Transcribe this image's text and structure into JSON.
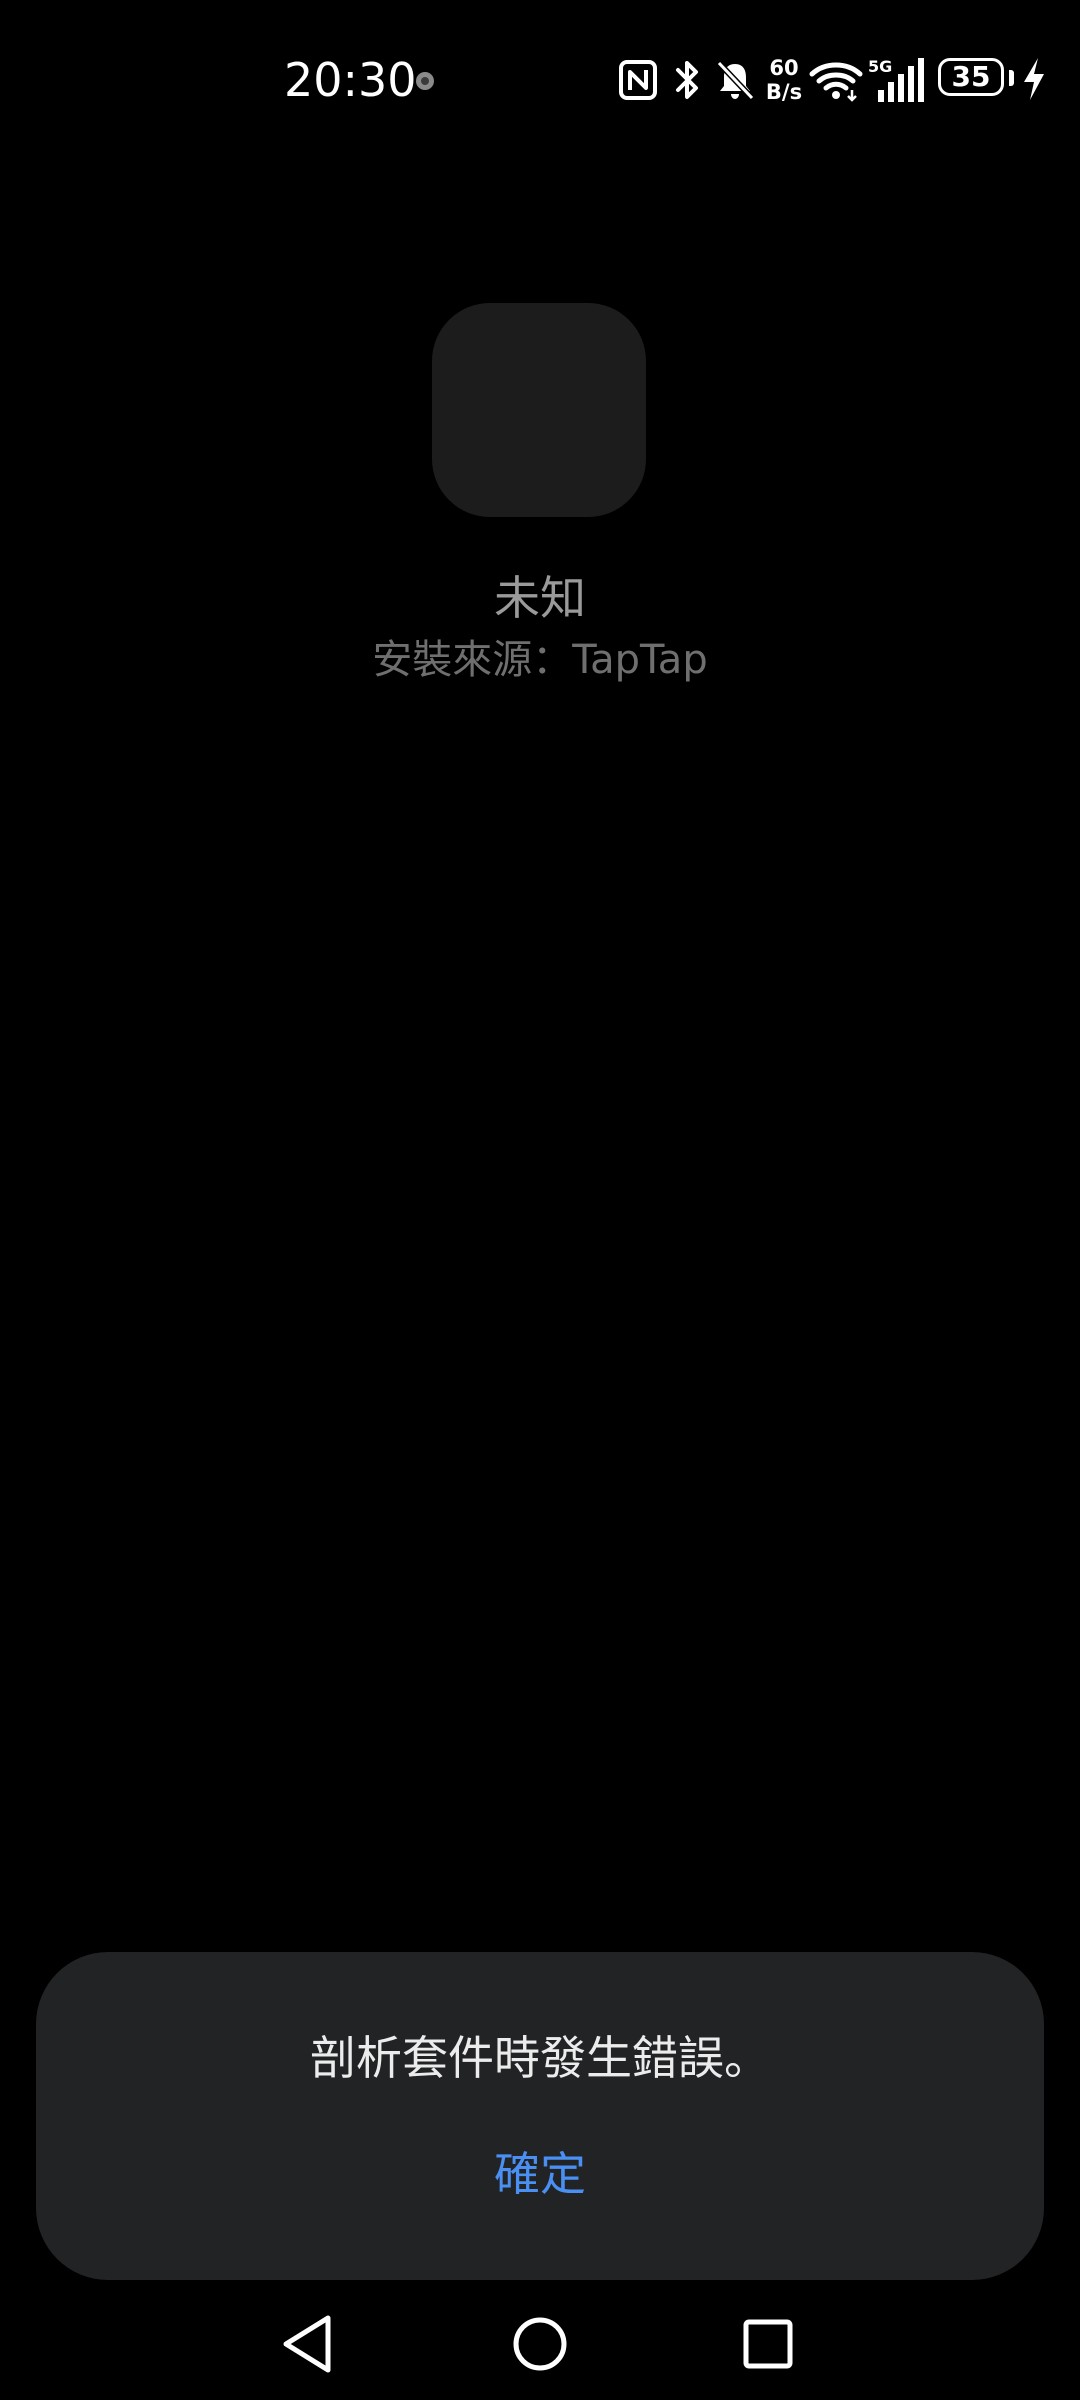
{
  "status_bar": {
    "time": "20:30",
    "net_speed_value": "60",
    "net_speed_unit": "B/s",
    "network_type": "5G",
    "battery_level": "35",
    "icons": [
      "notification-dot-icon",
      "nfc-icon",
      "bluetooth-icon",
      "mute-bell-icon",
      "wifi-icon",
      "cell-signal-icon",
      "battery-icon",
      "charging-bolt-icon"
    ]
  },
  "app": {
    "name": "未知",
    "install_source": "安裝來源：TapTap"
  },
  "dialog": {
    "message": "剖析套件時發生錯誤。",
    "ok_label": "確定"
  },
  "nav_bar": {
    "icons": [
      "back-icon",
      "home-icon",
      "recents-icon"
    ]
  },
  "colors": {
    "background": "#000000",
    "app_icon_placeholder": "#1c1c1c",
    "dialog_background": "#222325",
    "accent": "#4a8ff2",
    "app_name": "#9a9a9a",
    "install_source": "#6f6f6f"
  }
}
